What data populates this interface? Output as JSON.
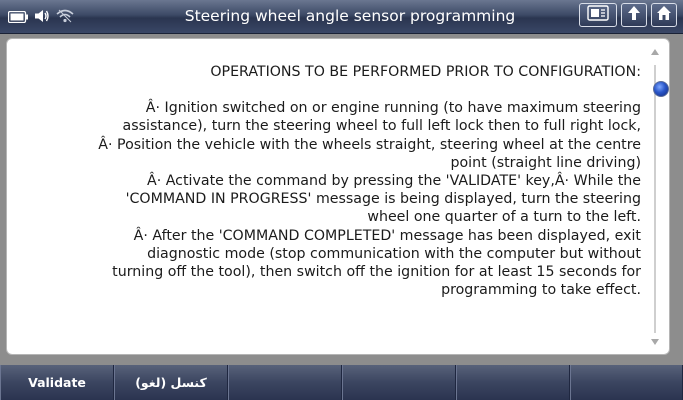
{
  "window": {
    "title": "Steering wheel angle sensor programming"
  },
  "status_icons": [
    "battery-icon",
    "speaker-icon",
    "wifi-icon"
  ],
  "top_buttons": [
    "screen-icon",
    "back-up-icon",
    "home-icon"
  ],
  "content": {
    "heading": "OPERATIONS TO BE PERFORMED PRIOR TO CONFIGURATION:",
    "body": "Â· Ignition switched on or engine running (to have maximum steering\nassistance), turn the steering wheel to full left lock then to full right lock,\nÂ· Position the vehicle with the wheels straight, steering wheel at the centre\npoint (straight line driving)\nÂ· Activate the command by pressing the 'VALIDATE' key,Â· While the\n'COMMAND IN PROGRESS' message is being displayed, turn the steering\nwheel one quarter of a turn to the left.\nÂ· After the 'COMMAND COMPLETED' message has been displayed, exit\ndiagnostic mode (stop communication with the computer but without\nturning off the tool), then switch off the ignition for at least 15 seconds for\nprogramming to take effect."
  },
  "bottom_bar": {
    "buttons": [
      "Validate",
      "كنسل (لغو)",
      "",
      "",
      "",
      "",
      ""
    ]
  },
  "colors": {
    "title_bar": "#3d4a66",
    "scroll_thumb": "#2a56c8",
    "background": "#8d8d8d"
  }
}
